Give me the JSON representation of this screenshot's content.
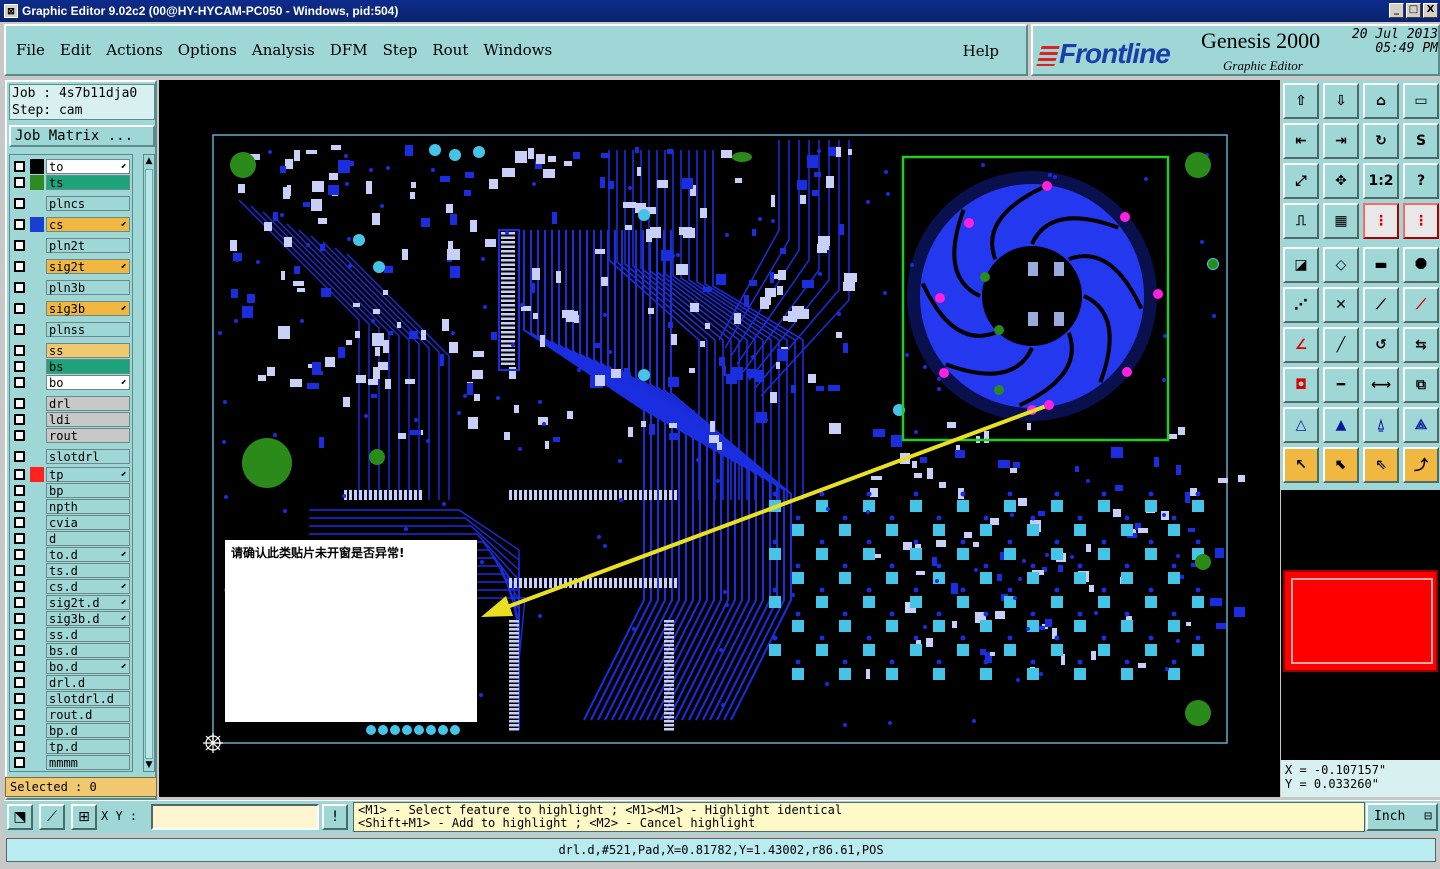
{
  "window": {
    "title": "Graphic Editor 9.02c2 (00@HY-HYCAM-PC050 - Windows, pid:504)",
    "btn_min": "_",
    "btn_max": "□",
    "btn_close": "X"
  },
  "menu": {
    "items": [
      "File",
      "Edit",
      "Actions",
      "Options",
      "Analysis",
      "DFM",
      "Step",
      "Rout",
      "Windows"
    ],
    "help": "Help"
  },
  "brand": {
    "logo": "Frontline",
    "product": "Genesis 2000",
    "subtitle": "Graphic Editor",
    "date": "20 Jul 2013",
    "time": "05:49 PM"
  },
  "job": {
    "job_line": "Job : 4s7b11dja0",
    "step_line": "Step: cam",
    "matrix_button": "Job Matrix ..."
  },
  "layers": [
    {
      "name": "to",
      "swatch": "#000000",
      "bg": "#ffffff",
      "editable": true
    },
    {
      "name": "ts",
      "swatch": "#2e8b22",
      "bg": "#1fa37a",
      "editable": false
    },
    {
      "name": "plncs",
      "swatch": "",
      "bg": "#9fd6d6",
      "editable": false
    },
    {
      "name": "cs",
      "swatch": "#1a3fd0",
      "bg": "#f0b840",
      "editable": true
    },
    {
      "name": "pln2t",
      "swatch": "",
      "bg": "#9fd6d6",
      "editable": false
    },
    {
      "name": "sig2t",
      "swatch": "",
      "bg": "#f0b840",
      "editable": true
    },
    {
      "name": "pln3b",
      "swatch": "",
      "bg": "#9fd6d6",
      "editable": false
    },
    {
      "name": "sig3b",
      "swatch": "",
      "bg": "#f0b840",
      "editable": true
    },
    {
      "name": "plnss",
      "swatch": "",
      "bg": "#9fd6d6",
      "editable": false
    },
    {
      "name": "ss",
      "swatch": "",
      "bg": "#f0c870",
      "editable": false
    },
    {
      "name": "bs",
      "swatch": "",
      "bg": "#1fa37a",
      "editable": false
    },
    {
      "name": "bo",
      "swatch": "",
      "bg": "#ffffff",
      "editable": true
    },
    {
      "name": "drl",
      "swatch": "",
      "bg": "#c8c8c8",
      "editable": false
    },
    {
      "name": "ldi",
      "swatch": "",
      "bg": "#c8c8c8",
      "editable": false
    },
    {
      "name": "rout",
      "swatch": "",
      "bg": "#c8c8c8",
      "editable": false
    },
    {
      "name": "slotdrl",
      "swatch": "",
      "bg": "#9fd6d6",
      "editable": false
    },
    {
      "name": "tp",
      "swatch": "#ff2020",
      "bg": "#9fd6d6",
      "editable": true
    },
    {
      "name": "bp",
      "swatch": "",
      "bg": "#9fd6d6",
      "editable": false
    },
    {
      "name": "npth",
      "swatch": "",
      "bg": "#9fd6d6",
      "editable": false
    },
    {
      "name": "cvia",
      "swatch": "",
      "bg": "#9fd6d6",
      "editable": false
    },
    {
      "name": "d",
      "swatch": "",
      "bg": "#9fd6d6",
      "editable": false
    },
    {
      "name": "to.d",
      "swatch": "",
      "bg": "#9fd6d6",
      "editable": true
    },
    {
      "name": "ts.d",
      "swatch": "",
      "bg": "#9fd6d6",
      "editable": false
    },
    {
      "name": "cs.d",
      "swatch": "",
      "bg": "#9fd6d6",
      "editable": true
    },
    {
      "name": "sig2t.d",
      "swatch": "",
      "bg": "#9fd6d6",
      "editable": true
    },
    {
      "name": "sig3b.d",
      "swatch": "",
      "bg": "#9fd6d6",
      "editable": true
    },
    {
      "name": "ss.d",
      "swatch": "",
      "bg": "#9fd6d6",
      "editable": false
    },
    {
      "name": "bs.d",
      "swatch": "",
      "bg": "#9fd6d6",
      "editable": false
    },
    {
      "name": "bo.d",
      "swatch": "",
      "bg": "#9fd6d6",
      "editable": true
    },
    {
      "name": "drl.d",
      "swatch": "",
      "bg": "#9fd6d6",
      "editable": false
    },
    {
      "name": "slotdrl.d",
      "swatch": "",
      "bg": "#9fd6d6",
      "editable": false
    },
    {
      "name": "rout.d",
      "swatch": "",
      "bg": "#9fd6d6",
      "editable": false
    },
    {
      "name": "bp.d",
      "swatch": "",
      "bg": "#9fd6d6",
      "editable": false
    },
    {
      "name": "tp.d",
      "swatch": "",
      "bg": "#9fd6d6",
      "editable": false
    },
    {
      "name": "mmmm",
      "swatch": "",
      "bg": "#9fd6d6",
      "editable": false
    }
  ],
  "layer_edit_mark": "⬋",
  "selected_label": "Selected : 0",
  "annotation_note": "请确认此类贴片未开窗是否异常!",
  "toolbox": {
    "icons": [
      "import-icon",
      "export-icon",
      "home-icon",
      "window-icon",
      "move-left-icon",
      "move-right-icon",
      "rotate-icon",
      "s-curve-icon",
      "fit-icon",
      "zoom-center-icon",
      "scale-1-2-icon",
      "help-icon",
      "ruler-tool-icon",
      "grid-icon",
      "layers-red-icon",
      "layers-red-2-icon",
      "snap-icon",
      "edit-shape-icon",
      "measure-icon",
      "octagon-icon",
      "connect-icon",
      "cross-icon",
      "line-node-icon",
      "line-node-red-icon",
      "angle-icon",
      "slash-icon",
      "arc-icon",
      "flip-icon",
      "pad-node-icon",
      "segment-icon",
      "dimension-icon",
      "group-icon",
      "triangle-warn-icon",
      "triangle-icon",
      "triangle-up-icon",
      "triangle-node-icon",
      "pointer-icon",
      "pointer-box-icon",
      "pointer-circle-icon",
      "pointer-route-icon"
    ],
    "labels": {
      "scale": "1:2",
      "help": "?"
    }
  },
  "coords": {
    "x": "X = -0.107157\"",
    "y": "Y = 0.033260\""
  },
  "bottom": {
    "xy_label": "X Y :",
    "xy_value": "",
    "msg_line1": "<M1> - Select feature to highlight ; <M1><M1> - Highlight identical",
    "msg_line2": "<Shift+M1> - Add to highlight ; <M2> - Cancel highlight",
    "unit": "Inch",
    "status": "drl.d,#521,Pad,X=0.81782,Y=1.43002,r86.61,POS"
  },
  "colors": {
    "panel": "#9fd6d6",
    "trace": "#1a2ee0",
    "pad": "#45c4e8",
    "fiducial": "#2a8a1a",
    "highlight_box": "#22cc22",
    "arrow": "#e8e020",
    "magenta_pad": "#ff20e0"
  }
}
